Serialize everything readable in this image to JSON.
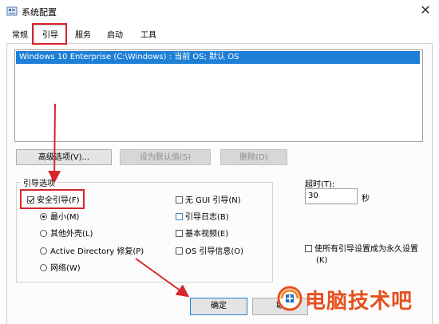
{
  "window": {
    "title": "系统配置",
    "close_glyph": "✕"
  },
  "tabs": [
    "常规",
    "引导",
    "服务",
    "启动",
    "工具"
  ],
  "os_list": {
    "selected": "Windows 10 Enterprise (C:\\Windows) : 当前 OS; 默认 OS"
  },
  "buttons": {
    "advanced": "高级选项(V)...",
    "set_default": "设为默认值(S)",
    "delete": "删除(D)",
    "ok": "确定",
    "cancel": "取"
  },
  "boot_options": {
    "group_label": "引导选项",
    "safe_boot": {
      "label": "安全引导(F)",
      "checked": true
    },
    "radios": [
      {
        "label": "最小(M)",
        "checked": true
      },
      {
        "label": "其他外壳(L)",
        "checked": false
      },
      {
        "label": "Active Directory 修复(P)",
        "checked": false
      },
      {
        "label": "网络(W)",
        "checked": false
      }
    ],
    "right_checks": [
      {
        "label": "无 GUI 引导(N)",
        "checked": false
      },
      {
        "label": "引导日志(B)",
        "checked": false
      },
      {
        "label": "基本视频(E)",
        "checked": false
      },
      {
        "label": "OS 引导信息(O)",
        "checked": false
      }
    ]
  },
  "timeout": {
    "label": "超时(T):",
    "value": "30",
    "unit": "秒"
  },
  "permanent": {
    "line1": "使所有引导设置成为永久设置",
    "line2": "(K)",
    "checked": false
  },
  "watermark": {
    "text": "电脑技术吧"
  },
  "colors": {
    "accent": "#1e7fd6",
    "annotation_red": "#d6262d",
    "watermark": "#e6501e"
  },
  "icons": {
    "app": "msconfig-icon",
    "close": "close-icon"
  }
}
